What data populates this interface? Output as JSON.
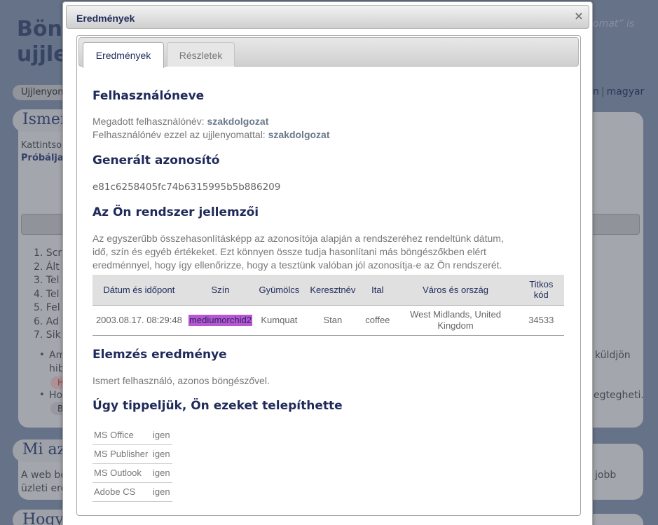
{
  "background": {
    "title_line1": "Böng",
    "title_line2": "ujjle",
    "tagline": "omat” is",
    "nav_left": "Ujjlenyom",
    "nav_right_link1": "n",
    "nav_right_link2": "magyar",
    "panel1_heading": "Ismer",
    "panel1_text1": "Kattintso",
    "panel1_text2": "Próbálja",
    "list_items": [
      "1. Scr",
      "2. Ált",
      "3. Tel",
      "4. Tel",
      "5. Fel",
      "6. Ad",
      "7. Sik"
    ],
    "bullet1_line1": "Am",
    "bullet1_line2": "hib",
    "bullet1_right": "küldjön",
    "bullet2_line1": "Ho",
    "bullet2_right": "egtegheti.",
    "pill1": "H",
    "pill2": "B",
    "panel2_heading": "Mi az",
    "panel2_text1": "A web bö",
    "panel2_text2": "üzleti ere",
    "panel2_right": "jobb",
    "panel3_heading": "Hogy"
  },
  "dialog": {
    "title": "Eredmények",
    "close_icon": "close-icon",
    "tabs": [
      {
        "label": "Eredmények",
        "active": true
      },
      {
        "label": "Részletek",
        "active": false
      }
    ]
  },
  "results": {
    "username_heading": "Felhasználóneve",
    "given_username_label": "Megadott felhasználónév:",
    "given_username_value": "szakdolgozat",
    "fingerprint_username_label": "Felhasználónév ezzel az ujjlenyomattal:",
    "fingerprint_username_value": "szakdolgozat",
    "generated_id_heading": "Generált azonosító",
    "generated_id": "e81c6258405fc74b6315995b5b886209",
    "attributes_heading": "Az Ön rendszer jellemzői",
    "attributes_desc_line1": "Az egyszerűbb összehasonlításképp az azonosítója alapján a rendszeréhez rendeltünk dátum,",
    "attributes_desc_line2": "idő, szín és egyéb értékeket. Ezt könnyen össze tudja hasonlítani más böngészőkben elért",
    "attributes_desc_line3": "eredménnyel, hogy így ellenőrizze, hogy a tesztünk valóban jól azonosítja-e az Ön rendszerét.",
    "table_headers": [
      "Dátum és időpont",
      "Szín",
      "Gyümölcs",
      "Keresztnév",
      "Ital",
      "Város és ország",
      "Titkos kód"
    ],
    "table_row": {
      "datetime": "2003.08.17. 08:29:48",
      "color": "mediumorchid2",
      "color_hex": "#ba55d3",
      "fruit": "Kumquat",
      "first_name": "Stan",
      "drink": "coffee",
      "city_country": "West Midlands, United Kingdom",
      "secret_code": "34533"
    },
    "analysis_heading": "Elemzés eredménye",
    "analysis_text": "Ismert felhasználó, azonos böngészővel.",
    "guess_heading": "Úgy tippeljük, Ön ezeket telepíthette",
    "software": [
      {
        "name": "MS Office",
        "value": "igen"
      },
      {
        "name": "MS Publisher",
        "value": "igen"
      },
      {
        "name": "MS Outlook",
        "value": "igen"
      },
      {
        "name": "Adobe CS",
        "value": "igen"
      }
    ]
  }
}
